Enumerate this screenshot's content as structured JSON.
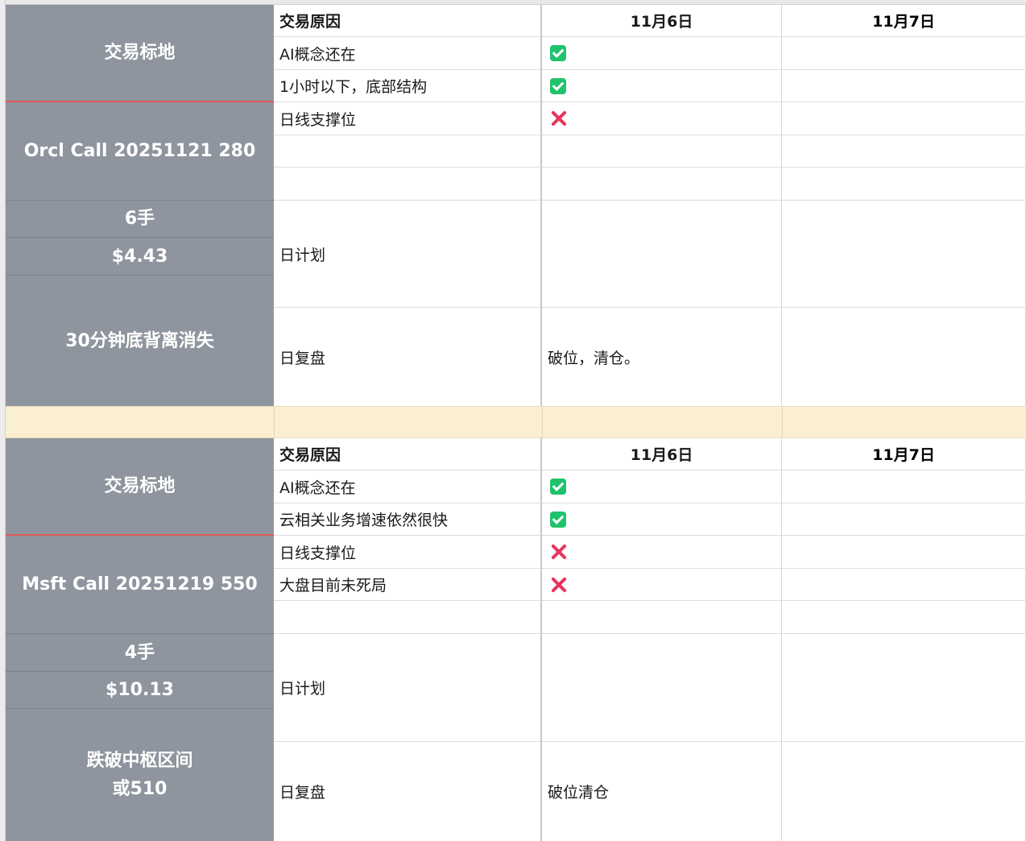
{
  "colors": {
    "check": "#1fc26d",
    "cross": "#e8355a",
    "left_panel": "#8f959f",
    "gap_row": "#faf0d0"
  },
  "blocks": [
    {
      "left": {
        "label": "交易标地",
        "ticker": "Orcl Call 20251121 280",
        "qty": "6手",
        "price": "$4.43",
        "note": "30分钟底背离消失"
      },
      "header": {
        "reason": "交易原因",
        "day1": "11月6日",
        "day2": "11月7日"
      },
      "rows": [
        {
          "reason": "AI概念还在",
          "day1": "check-icon"
        },
        {
          "reason": "1小时以下，底部结构",
          "day1": "check-icon"
        },
        {
          "reason": "日线支撑位",
          "day1": "cross-icon"
        },
        {
          "reason": "",
          "day1": ""
        },
        {
          "reason": "",
          "day1": ""
        }
      ],
      "plan": {
        "label": "日计划",
        "day1": "",
        "day2": ""
      },
      "review": {
        "label": "日复盘",
        "day1": "破位，清仓。",
        "day2": ""
      }
    },
    {
      "left": {
        "label": "交易标地",
        "ticker": "Msft Call 20251219 550",
        "qty": "4手",
        "price": "$10.13",
        "note": "跌破中枢区间\n或510"
      },
      "header": {
        "reason": "交易原因",
        "day1": "11月6日",
        "day2": "11月7日"
      },
      "rows": [
        {
          "reason": "AI概念还在",
          "day1": "check-icon"
        },
        {
          "reason": "云相关业务增速依然很快",
          "day1": "check-icon"
        },
        {
          "reason": "日线支撑位",
          "day1": "cross-icon"
        },
        {
          "reason": "大盘目前未死局",
          "day1": "cross-icon"
        },
        {
          "reason": "",
          "day1": ""
        }
      ],
      "plan": {
        "label": "日计划",
        "day1": "",
        "day2": ""
      },
      "review": {
        "label": "日复盘",
        "day1": "破位清仓",
        "day2": ""
      }
    }
  ]
}
